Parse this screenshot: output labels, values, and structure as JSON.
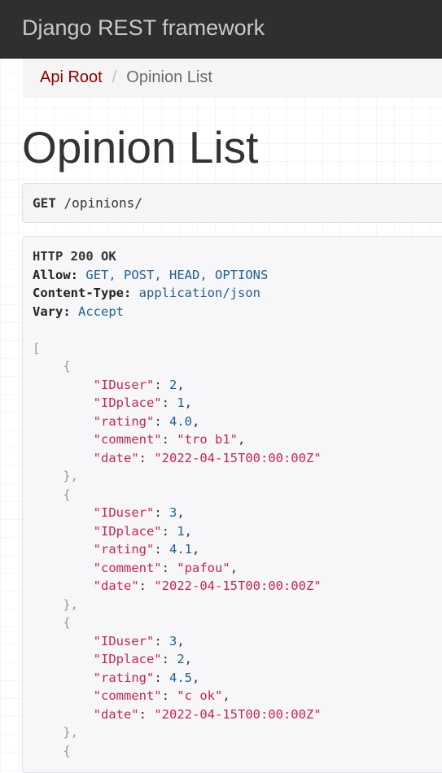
{
  "navbar": {
    "brand": "Django REST framework"
  },
  "breadcrumb": {
    "root_label": "Api Root",
    "separator": "/",
    "current": "Opinion List"
  },
  "page_title": "Opinion List",
  "request": {
    "method": "GET",
    "path": "/opinions/"
  },
  "response": {
    "status": "HTTP 200 OK",
    "headers": [
      {
        "name": "Allow",
        "value": "GET, POST, HEAD, OPTIONS"
      },
      {
        "name": "Content-Type",
        "value": "application/json"
      },
      {
        "name": "Vary",
        "value": "Accept"
      }
    ],
    "items": [
      {
        "IDuser": "2",
        "IDplace": "1",
        "rating": "4.0",
        "comment": "tro b1",
        "date": "2022-04-15T00:00:00Z"
      },
      {
        "IDuser": "3",
        "IDplace": "1",
        "rating": "4.1",
        "comment": "pafou",
        "date": "2022-04-15T00:00:00Z"
      },
      {
        "IDuser": "3",
        "IDplace": "2",
        "rating": "4.5",
        "comment": "c ok",
        "date": "2022-04-15T00:00:00Z"
      }
    ]
  },
  "colors": {
    "navbar_bg": "#2f2f2f",
    "brand_text": "#c9c9c9",
    "link": "#8b0000",
    "json_key": "#c7254e",
    "json_number": "#1f5f8b"
  }
}
